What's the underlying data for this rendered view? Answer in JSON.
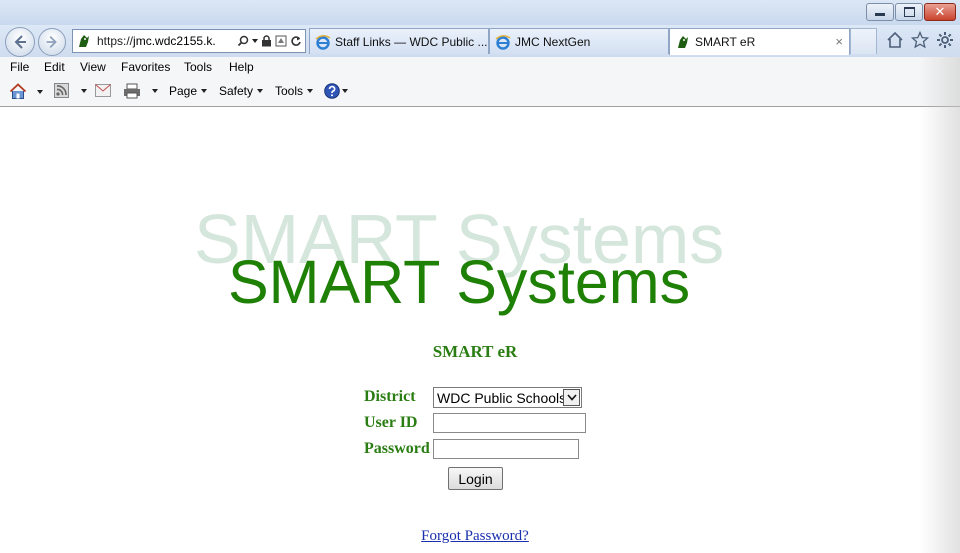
{
  "browser": {
    "address": {
      "scheme": "https://",
      "host": "jmc.wdc2155.k."
    },
    "tabs": [
      {
        "label": "Staff Links — WDC Public ..."
      },
      {
        "label": "JMC NextGen"
      },
      {
        "label": "SMART eR",
        "close": "×"
      }
    ],
    "menu": [
      "File",
      "Edit",
      "View",
      "Favorites",
      "Tools",
      "Help"
    ],
    "commands": {
      "page": "Page",
      "safety": "Safety",
      "tools": "Tools"
    }
  },
  "page": {
    "logo_shadow": "SMART Systems",
    "logo": "SMART Systems",
    "app_title": "SMART eR",
    "form": {
      "district_label": "District",
      "district_value": "WDC Public Schools",
      "userid_label": "User ID",
      "userid_value": "",
      "password_label": "Password",
      "password_value": "",
      "login_label": "Login"
    },
    "forgot_password": "Forgot Password?"
  },
  "colors": {
    "logo_green": "#1f8006",
    "label_green": "#2a7d12",
    "link_blue": "#1a2fae"
  }
}
